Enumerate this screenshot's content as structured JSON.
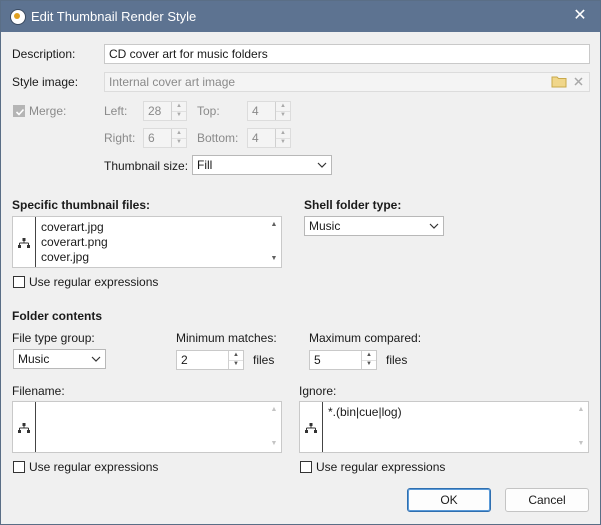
{
  "window": {
    "title": "Edit Thumbnail Render Style",
    "close_icon": "close-icon"
  },
  "description": {
    "label": "Description:",
    "value": "CD cover art for music folders"
  },
  "style_image": {
    "label": "Style image:",
    "placeholder": "Internal cover art image"
  },
  "merge": {
    "label": "Merge:",
    "checked": true,
    "left_label": "Left:",
    "left_value": "28",
    "top_label": "Top:",
    "top_value": "4",
    "right_label": "Right:",
    "right_value": "6",
    "bottom_label": "Bottom:",
    "bottom_value": "4"
  },
  "thumbnail_size": {
    "label": "Thumbnail size:",
    "value": "Fill"
  },
  "specific_files": {
    "label": "Specific thumbnail files:",
    "items": [
      "coverart.jpg",
      "coverart.png",
      "cover.jpg"
    ],
    "regex_label": "Use regular expressions"
  },
  "shell_folder": {
    "label": "Shell folder type:",
    "value": "Music"
  },
  "folder_contents": {
    "heading": "Folder contents",
    "file_type_group_label": "File type group:",
    "file_type_group_value": "Music",
    "min_matches_label": "Minimum matches:",
    "min_matches_value": "2",
    "min_matches_unit": "files",
    "max_compared_label": "Maximum compared:",
    "max_compared_value": "5",
    "max_compared_unit": "files"
  },
  "filename": {
    "label": "Filename:",
    "items": [],
    "regex_label": "Use regular expressions"
  },
  "ignore": {
    "label": "Ignore:",
    "items": [
      "*.(bin|cue|log)"
    ],
    "regex_label": "Use regular expressions"
  },
  "buttons": {
    "ok": "OK",
    "cancel": "Cancel"
  }
}
